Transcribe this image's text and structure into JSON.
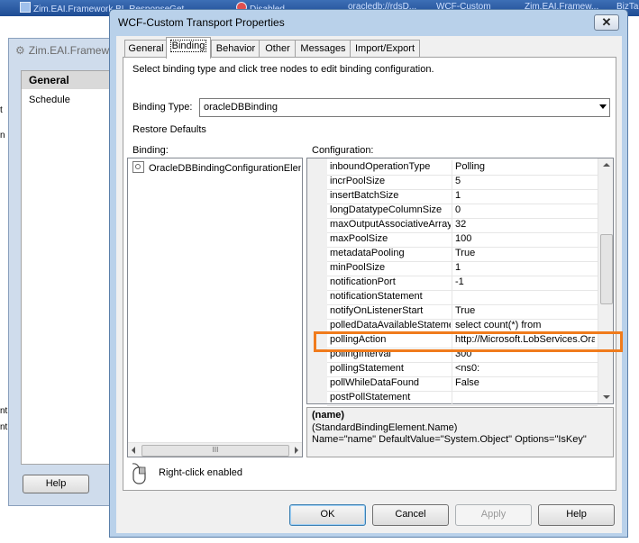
{
  "taskbar": {
    "items": [
      "Zim.EAI.Framework.BL.ResponseGet...",
      "Disabled",
      "oracledb://rdsD...",
      "WCF-Custom",
      "Zim.EAI.Framew...",
      "BizTa"
    ]
  },
  "background_window": {
    "title": "Zim.EAI.Framew",
    "nav": {
      "general": "General",
      "schedule": "Schedule"
    },
    "help_button": "Help",
    "edge_chars": [
      "t",
      "n",
      "nt",
      "nt"
    ]
  },
  "dialog": {
    "title": "WCF-Custom Transport Properties",
    "close_glyph": "✕",
    "tabs": [
      {
        "label": "General",
        "active": false
      },
      {
        "label": "Binding",
        "active": true
      },
      {
        "label": "Behavior",
        "active": false
      },
      {
        "label": "Other",
        "active": false
      },
      {
        "label": "Messages",
        "active": false
      },
      {
        "label": "Import/Export",
        "active": false
      }
    ],
    "instructions": "Select binding type and click tree nodes to edit binding configuration.",
    "binding_type_label": "Binding Type:",
    "binding_type_value": "oracleDBBinding",
    "restore_defaults": "Restore Defaults",
    "binding_label": "Binding:",
    "configuration_label": "Configuration:",
    "tree_node": "OracleDBBindingConfigurationElem",
    "properties": [
      {
        "name": "inboundOperationType",
        "value": "Polling"
      },
      {
        "name": "incrPoolSize",
        "value": "5"
      },
      {
        "name": "insertBatchSize",
        "value": "1"
      },
      {
        "name": "longDatatypeColumnSize",
        "value": "0"
      },
      {
        "name": "maxOutputAssociativeArrayE",
        "value": "32"
      },
      {
        "name": "maxPoolSize",
        "value": "100"
      },
      {
        "name": "metadataPooling",
        "value": "True"
      },
      {
        "name": "minPoolSize",
        "value": "1"
      },
      {
        "name": "notificationPort",
        "value": "-1"
      },
      {
        "name": "notificationStatement",
        "value": ""
      },
      {
        "name": "notifyOnListenerStart",
        "value": "True"
      },
      {
        "name": "polledDataAvailableStateme",
        "value": "select count(*) from"
      },
      {
        "name": "pollingAction",
        "value": "http://Microsoft.LobServices.Ora"
      },
      {
        "name": "pollingInterval",
        "value": "300"
      },
      {
        "name": "pollingStatement",
        "value": "<ns0:"
      },
      {
        "name": "pollWhileDataFound",
        "value": "False"
      },
      {
        "name": "postPollStatement",
        "value": ""
      }
    ],
    "highlight_color": "#f07b1c",
    "description": {
      "name": "(name)",
      "line1": "(StandardBindingElement.Name)",
      "line2": "Name=\"name\" DefaultValue=\"System.Object\" Options=\"IsKey\""
    },
    "hscroll_grip": "III",
    "right_click_text": "Right-click enabled",
    "buttons": {
      "ok": "OK",
      "cancel": "Cancel",
      "apply": "Apply",
      "help": "Help"
    }
  }
}
